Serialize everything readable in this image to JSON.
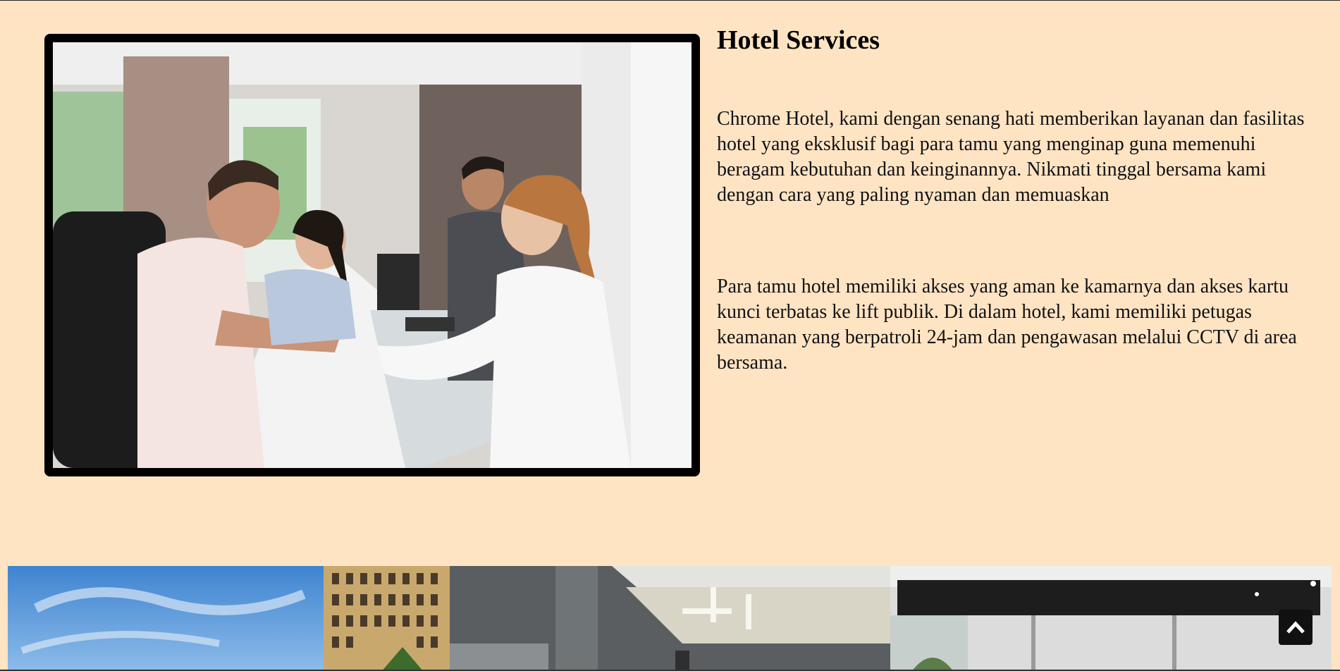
{
  "services": {
    "title": "Hotel Services",
    "paragraph1": "Chrome Hotel, kami dengan senang hati memberikan layanan dan fasilitas hotel yang eksklusif bagi para tamu yang menginap guna memenuhi beragam kebutuhan dan keinginannya. Nikmati tinggal bersama kami dengan cara yang paling nyaman dan memuaskan",
    "paragraph2": "Para tamu hotel memiliki akses yang aman ke kamarnya dan akses kartu kunci terbatas ke lift publik. Di dalam hotel, kami memiliki petugas keamanan yang berpatroli 24-jam dan pengawasan melalui CCTV di area bersama."
  },
  "icons": {
    "scroll_top": "chevron-up-icon"
  },
  "colors": {
    "background": "#ffe4c4",
    "frame": "#000000",
    "button": "#111111"
  }
}
